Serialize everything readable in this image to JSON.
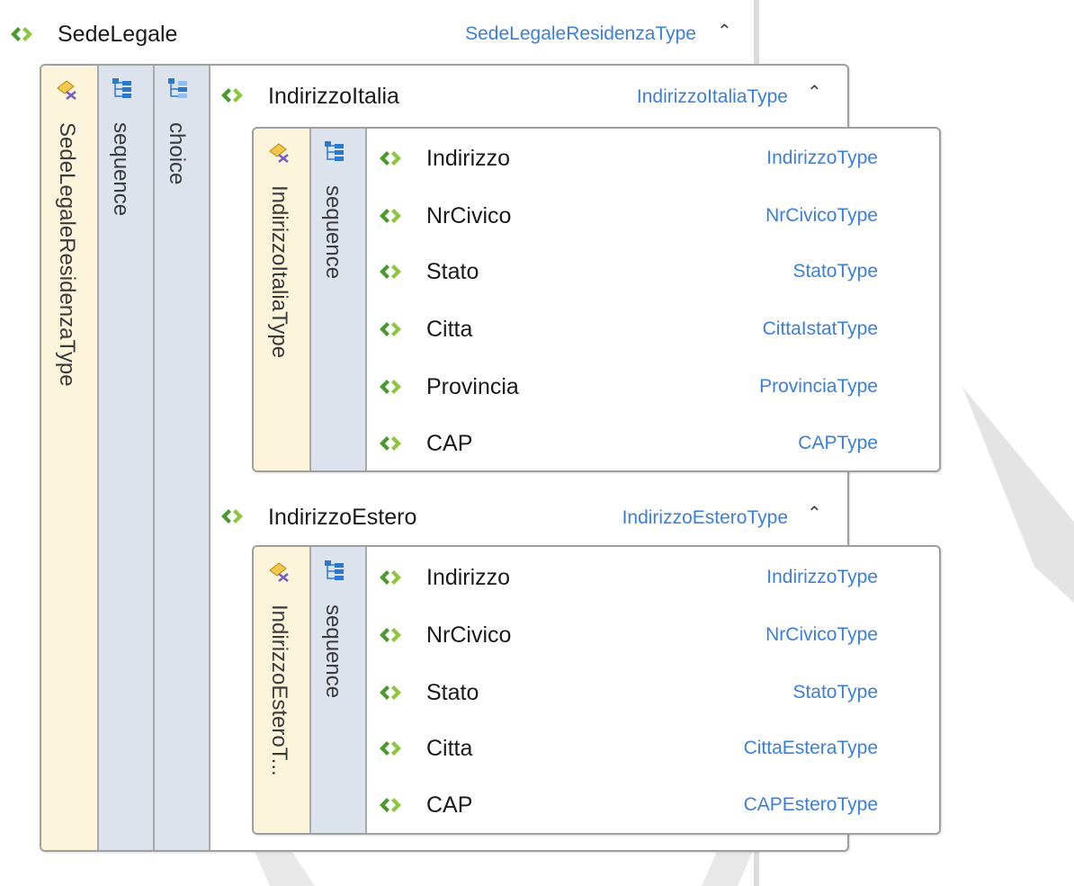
{
  "root": {
    "name": "SedeLegale",
    "type": "SedeLegaleResidenzaType"
  },
  "root_columns": {
    "type_label": "SedeLegaleResidenzaType",
    "seq_label": "sequence",
    "choice_label": "choice"
  },
  "italia": {
    "name": "IndirizzoItalia",
    "type": "IndirizzoItaliaType",
    "type_col": "IndirizzoItaliaType",
    "seq_col": "sequence",
    "children": [
      {
        "name": "Indirizzo",
        "type": "IndirizzoType"
      },
      {
        "name": "NrCivico",
        "type": "NrCivicoType"
      },
      {
        "name": "Stato",
        "type": "StatoType"
      },
      {
        "name": "Citta",
        "type": "CittaIstatType"
      },
      {
        "name": "Provincia",
        "type": "ProvinciaType"
      },
      {
        "name": "CAP",
        "type": "CAPType"
      }
    ]
  },
  "estero": {
    "name": "IndirizzoEstero",
    "type": "IndirizzoEsteroType",
    "type_col": "IndirizzoEsteroT...",
    "seq_col": "sequence",
    "children": [
      {
        "name": "Indirizzo",
        "type": "IndirizzoType"
      },
      {
        "name": "NrCivico",
        "type": "NrCivicoType"
      },
      {
        "name": "Stato",
        "type": "StatoType"
      },
      {
        "name": "Citta",
        "type": "CittaEsteraType"
      },
      {
        "name": "CAP",
        "type": "CAPEsteroType"
      }
    ]
  },
  "icons": {
    "element": "element-icon",
    "complex_type": "complex-type-icon",
    "sequence": "sequence-icon",
    "choice": "choice-icon",
    "collapse": "collapse-chevron-icon"
  },
  "colors": {
    "type_text": "#3c7fd6",
    "element_icon": "#6ab04c",
    "type_column": "#fcf5db",
    "sequence_column": "#dde3ec"
  }
}
